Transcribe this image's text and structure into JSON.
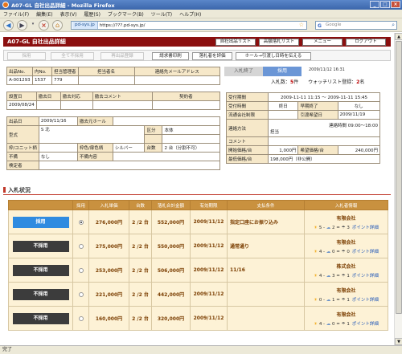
{
  "window": {
    "title": "A07-GL 自社出品詳細 - Mozilla Firefox",
    "minimize": "_",
    "maximize": "□",
    "close": "×"
  },
  "menu": [
    "ファイル(F)",
    "編集(E)",
    "表示(V)",
    "履歴(S)",
    "ブックマーク(B)",
    "ツール(T)",
    "ヘルプ(H)"
  ],
  "nav": {
    "site": "pd-sys.jp",
    "url": "https://???.pd-sys.jp/",
    "search_placeholder": "Google"
  },
  "page": {
    "title": "A07-GL 自社出品詳細",
    "header_buttons": [
      "自社出品リスト",
      "高額落札リスト",
      "メニュー",
      "ログアウト"
    ],
    "toolbar": {
      "adopt": "採用",
      "reject_all": "全て不採用",
      "reexhibit": "再出品登録",
      "invoice": "請求書印刷",
      "rate": "落札者を評価",
      "extend": "ホール→引渡し日時を伝える"
    },
    "status": {
      "done_tab": "入札終了",
      "adopt_tab": "採用",
      "datetime": "2009/11/12 16:31",
      "bid_label": "入札数：",
      "bid_count": "5",
      "bid_unit": "件",
      "watch_label": "ウォッチリスト登録：",
      "watch_count": "2",
      "watch_unit": "名"
    },
    "info": {
      "h_no": "出品No.",
      "h_inner": "内No.",
      "h_mgr": "担当管理者",
      "h_person": "担当者名",
      "h_mail": "連絡先メールアドレス",
      "v_no": "A-001293",
      "v_inner": "1537",
      "v_mgr": "779",
      "v_person": "",
      "v_mail": "",
      "h_setup": "設置日",
      "h_remove": "撤去日",
      "h_remove_support": "撤去対応",
      "h_remove_comment": "撤去コメント",
      "h_contract": "契約者",
      "v_setup": "2009/08/24",
      "h_exhibit_date": "出品日",
      "v_exhibit_date": "2009/11/16",
      "h_hall": "撤去元ホール",
      "h_model": "型式",
      "v_model": "S 北",
      "h_class": "区分",
      "v_class": "本体",
      "h_frame": "枠/ユニット柄",
      "h_frame_color": "枠色/扉色柄",
      "v_frame_color": "シルバー",
      "h_units": "台数",
      "v_units": "2 台（分割不可）",
      "h_defect": "不備",
      "v_defect": "なし",
      "h_defect_detail": "不備内容",
      "h_inspector": "検定者"
    },
    "dealinfo": {
      "h_period": "受付期間",
      "v_period": "2009-11-11 11:15 〜 2009-11-11 15:45",
      "h_time": "受付時間",
      "v_time_from": "終日",
      "h_area": "早期終了",
      "v_area": "なし",
      "h_carrier": "流通会社制限",
      "h_pickup": "引渡希望日",
      "v_pickup": "2009/11/19",
      "h_contact": "連絡方法",
      "v_contact_time": "連絡時間 09:00〜18:00",
      "v_contact_method": "担当",
      "h_comment": "コメント",
      "h_start": "開始価格/台",
      "v_start": "1,000円",
      "h_hope": "希望価格/台",
      "v_hope": "240,000円",
      "h_min": "最低価格/台",
      "v_min": "198,000円（非公開）"
    },
    "bids_section_title": "入札状況",
    "bids_headers": [
      "",
      "採用",
      "入札単価",
      "台数",
      "落札合計金額",
      "有効期限",
      "支払条件",
      "入札者情報"
    ],
    "bids": [
      {
        "status": "採用",
        "adopted": true,
        "price": "276,000円",
        "qty": "2 /2 台",
        "total": "552,000円",
        "expire": "2009/11/12",
        "cond": "指定口座にお振り込み",
        "company": "有限会社",
        "e_good": "5",
        "e_mid": "2",
        "e_bad": "3",
        "point": "ポイント詳細"
      },
      {
        "status": "不採用",
        "adopted": false,
        "price": "275,000円",
        "qty": "2 /2 台",
        "total": "550,000円",
        "expire": "2009/11/12",
        "cond": "通常通り",
        "company": "有限会社",
        "e_good": "4",
        "e_mid": "0",
        "e_bad": "0",
        "point": "ポイント詳細"
      },
      {
        "status": "不採用",
        "adopted": false,
        "price": "253,000円",
        "qty": "2 /2 台",
        "total": "506,000円",
        "expire": "2009/11/12",
        "cond": "11/16",
        "company": "株式会社",
        "e_good": "4",
        "e_mid": "3",
        "e_bad": "1",
        "point": "ポイント詳細"
      },
      {
        "status": "不採用",
        "adopted": false,
        "price": "221,000円",
        "qty": "2 /2 台",
        "total": "442,000円",
        "expire": "2009/11/12",
        "cond": "",
        "company": "有限会社",
        "e_good": "0",
        "e_mid": "1",
        "e_bad": "1",
        "point": "ポイント詳細"
      },
      {
        "status": "不採用",
        "adopted": false,
        "price": "160,000円",
        "qty": "2 /2 台",
        "total": "320,000円",
        "expire": "2009/11/12",
        "cond": "",
        "company": "有限会社",
        "e_good": "4",
        "e_mid": "0",
        "e_bad": "1",
        "point": "ポイント詳細"
      }
    ]
  },
  "statusbar": "完了"
}
